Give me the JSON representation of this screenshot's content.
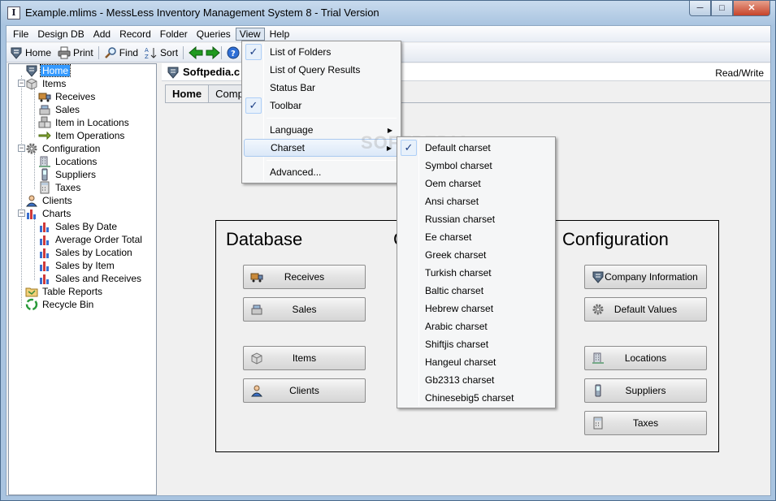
{
  "window": {
    "title": "Example.mlims - MessLess Inventory Management System 8 - Trial Version",
    "app_icon": "I"
  },
  "controls": {
    "minimize": "─",
    "maximize": "□",
    "close": "✕"
  },
  "menu": [
    "File",
    "Design DB",
    "Add",
    "Record",
    "Folder",
    "Queries",
    "View",
    "Help"
  ],
  "toolbar": {
    "home": "Home",
    "print": "Print",
    "find": "Find",
    "sort": "Sort",
    "help": "H"
  },
  "tree": [
    {
      "label": "Home",
      "selected": true
    },
    {
      "label": "Items"
    },
    {
      "label": "Receives"
    },
    {
      "label": "Sales"
    },
    {
      "label": "Item in Locations"
    },
    {
      "label": "Item Operations"
    },
    {
      "label": "Configuration"
    },
    {
      "label": "Locations"
    },
    {
      "label": "Suppliers"
    },
    {
      "label": "Taxes"
    },
    {
      "label": "Clients"
    },
    {
      "label": "Charts"
    },
    {
      "label": "Sales By Date"
    },
    {
      "label": "Average Order Total"
    },
    {
      "label": "Sales by Location"
    },
    {
      "label": "Sales by Item"
    },
    {
      "label": "Sales and Receives"
    },
    {
      "label": "Table Reports"
    },
    {
      "label": "Recycle Bin"
    }
  ],
  "header": {
    "logo": "Softpedia.c",
    "mode": "Read/Write"
  },
  "tabs": [
    "Home",
    "Comp"
  ],
  "sections": {
    "database": "Database",
    "middle": "C",
    "configuration": "Configuration"
  },
  "db_buttons": [
    "Receives",
    "Sales",
    "Items",
    "Clients"
  ],
  "config_buttons": [
    "Company Information",
    "Default Values",
    "Locations",
    "Suppliers",
    "Taxes"
  ],
  "view_menu": {
    "items": [
      "List of Folders",
      "List of Query Results",
      "Status Bar",
      "Toolbar",
      "Language",
      "Charset",
      "Advanced..."
    ],
    "checked": [
      "List of Folders",
      "Toolbar"
    ]
  },
  "charset_menu": [
    "Default charset",
    "Symbol charset",
    "Oem charset",
    "Ansi charset",
    "Russian charset",
    "Ee charset",
    "Greek charset",
    "Turkish charset",
    "Baltic charset",
    "Hebrew charset",
    "Arabic charset",
    "Shiftjis charset",
    "Hangeul charset",
    "Gb2313 charset",
    "Chinesebig5 charset"
  ],
  "watermark": "SOFTPEDIA",
  "colors": {
    "selection": "#3399ff",
    "check": "#1a3d84",
    "title_bar": "#a9c4e0"
  }
}
